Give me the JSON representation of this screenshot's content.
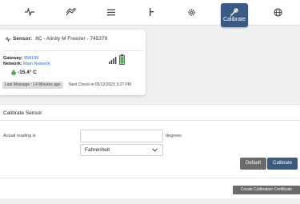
{
  "toolbar": {
    "tools": [
      {
        "icon": "activity-icon"
      },
      {
        "icon": "trend-icon"
      },
      {
        "icon": "list-icon"
      },
      {
        "icon": "fork-icon"
      },
      {
        "icon": "gear-icon"
      },
      {
        "icon": "wrench-icon",
        "label": "Calibrate",
        "active": true
      },
      {
        "icon": "globe-icon"
      }
    ],
    "active_color": "#395a82"
  },
  "sensor": {
    "label": "Sensor:",
    "name": "8C - Alinity M Freezer - 745379",
    "gateway_label": "Gateway:",
    "gateway_value": "958199",
    "network_label": "Network:",
    "network_value": "Main Network",
    "temperature": "-15.4° C",
    "last_message": "Last Message : 14 Minutes ago",
    "next_checkin": "Next Check-in:05/12/2023 3:27 PM",
    "signal_icon": "signal-icon",
    "battery_icon": "battery-icon",
    "status_color": "#4caf50"
  },
  "calibrate": {
    "title": "Calibrate Sensor",
    "reading_label": "Actual reading is",
    "reading_value": "",
    "unit_label": "degrees",
    "unit_selected": "Fahrenheit",
    "default_button": "Default",
    "calibrate_button": "Calibrate",
    "certificate_button": "Create Calibration Certificate"
  }
}
